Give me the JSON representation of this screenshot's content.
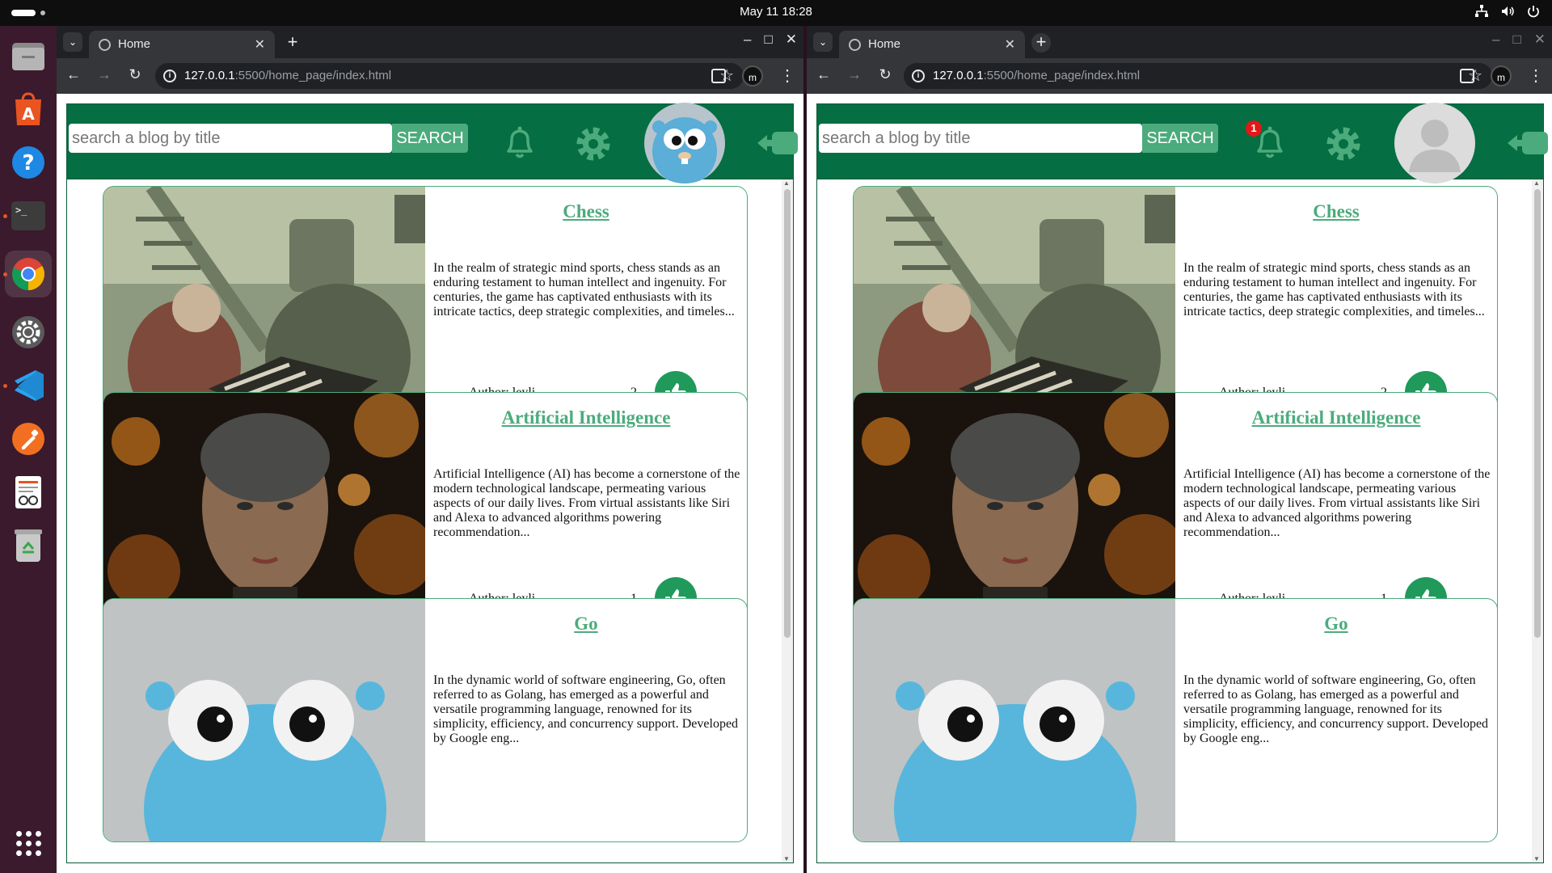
{
  "system": {
    "clock": "May 11  18:28"
  },
  "dock": {
    "apps": [
      "files",
      "app-center",
      "help",
      "terminal",
      "chrome",
      "settings",
      "vscode",
      "color-picker",
      "text-editor",
      "trash"
    ],
    "show_apps": "show-applications"
  },
  "windows": [
    {
      "tab_title": "Home",
      "url_host": "127.0.0.1",
      "url_rest": ":5500/home_page/index.html",
      "profile_initial": "m",
      "search": {
        "placeholder": "search a blog by title",
        "button": "SEARCH"
      },
      "notification_count": "",
      "avatar": "gopher",
      "posts": [
        {
          "title": "Chess",
          "excerpt": "In the realm of strategic mind sports, chess stands as an enduring testament to human intellect and ingenuity. For centuries, the game has captivated enthusiasts with its intricate tactics, deep strategic complexities, and timeles...",
          "author": "Author: leyli",
          "likes": "2"
        },
        {
          "title": "Artificial Intelligence",
          "excerpt": "Artificial Intelligence (AI) has become a cornerstone of the modern technological landscape, permeating various aspects of our daily lives. From virtual assistants like Siri and Alexa to advanced algorithms powering recommendation...",
          "author": "Author: leyli",
          "likes": "1"
        },
        {
          "title": "Go",
          "excerpt": "In the dynamic world of software engineering, Go, often referred to as Golang, has emerged as a powerful and versatile programming language, renowned for its simplicity, efficiency, and concurrency support. Developed by Google eng...",
          "author": "",
          "likes": ""
        }
      ]
    },
    {
      "tab_title": "Home",
      "url_host": "127.0.0.1",
      "url_rest": ":5500/home_page/index.html",
      "profile_initial": "m",
      "search": {
        "placeholder": "search a blog by title",
        "button": "SEARCH"
      },
      "notification_count": "1",
      "avatar": "default-user",
      "posts": [
        {
          "title": "Chess",
          "excerpt": "In the realm of strategic mind sports, chess stands as an enduring testament to human intellect and ingenuity. For centuries, the game has captivated enthusiasts with its intricate tactics, deep strategic complexities, and timeles...",
          "author": "Author: leyli",
          "likes": "2"
        },
        {
          "title": "Artificial Intelligence",
          "excerpt": "Artificial Intelligence (AI) has become a cornerstone of the modern technological landscape, permeating various aspects of our daily lives. From virtual assistants like Siri and Alexa to advanced algorithms powering recommendation...",
          "author": "Author: leyli",
          "likes": "1"
        },
        {
          "title": "Go",
          "excerpt": "In the dynamic world of software engineering, Go, often referred to as Golang, has emerged as a powerful and versatile programming language, renowned for its simplicity, efficiency, and concurrency support. Developed by Google eng...",
          "author": "",
          "likes": ""
        }
      ]
    }
  ],
  "colors": {
    "brand_green": "#056e43",
    "accent_green": "#4cab7c",
    "like_green": "#1f9a5b",
    "badge_red": "#e21818"
  }
}
